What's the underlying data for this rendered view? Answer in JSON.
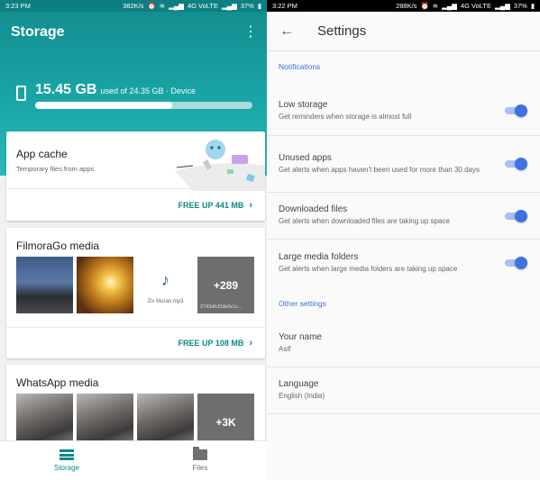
{
  "left": {
    "status_bar": {
      "time": "3:23 PM",
      "speed": "382K/s",
      "network": "4G VoLTE",
      "battery": "37%"
    },
    "app_title": "Storage",
    "menu_icon": "more-vert-icon",
    "device": {
      "icon": "phone-icon",
      "used": "15.45 GB",
      "detail": "used of 24.35 GB · Device",
      "used_fraction": 0.63
    },
    "app_cache": {
      "title": "App cache",
      "subtitle": "Temporary files from apps",
      "action": "FREE UP 441 MB"
    },
    "filmora": {
      "title": "FilmoraGo media",
      "music_label": "Ziv Moran.mp3",
      "more_count": "+289",
      "more_file": "2743dfcf2db0e1c...",
      "action": "FREE UP 108 MB"
    },
    "whatsapp": {
      "title": "WhatsApp media",
      "more_count": "+3K"
    },
    "bottom_nav": [
      {
        "label": "Storage",
        "icon": "storage-list-icon",
        "active": true
      },
      {
        "label": "Files",
        "icon": "folder-icon",
        "active": false
      }
    ]
  },
  "right": {
    "status_bar": {
      "time": "3:22 PM",
      "speed": "288K/s",
      "network": "4G VoLTE",
      "battery": "37%"
    },
    "title": "Settings",
    "back_icon": "arrow-back-icon",
    "notifications_header": "Notifications",
    "prefs": [
      {
        "title": "Low storage",
        "subtitle": "Get reminders when storage is almost full",
        "enabled": true
      },
      {
        "title": "Unused apps",
        "subtitle": "Get alerts when apps haven't been used for more than 30 days",
        "enabled": true
      },
      {
        "title": "Downloaded files",
        "subtitle": "Get alerts when downloaded files are taking up space",
        "enabled": true
      },
      {
        "title": "Large media folders",
        "subtitle": "Get alerts when large media folders are taking up space",
        "enabled": true
      }
    ],
    "other_header": "Other settings",
    "name": {
      "title": "Your name",
      "value": "Asif"
    },
    "language": {
      "title": "Language",
      "value": "English (India)"
    }
  },
  "colors": {
    "teal": "#138e91",
    "teal_action": "#0b8a8a",
    "blue_accent": "#3f72e0",
    "blue_header": "#3f6fd8"
  }
}
